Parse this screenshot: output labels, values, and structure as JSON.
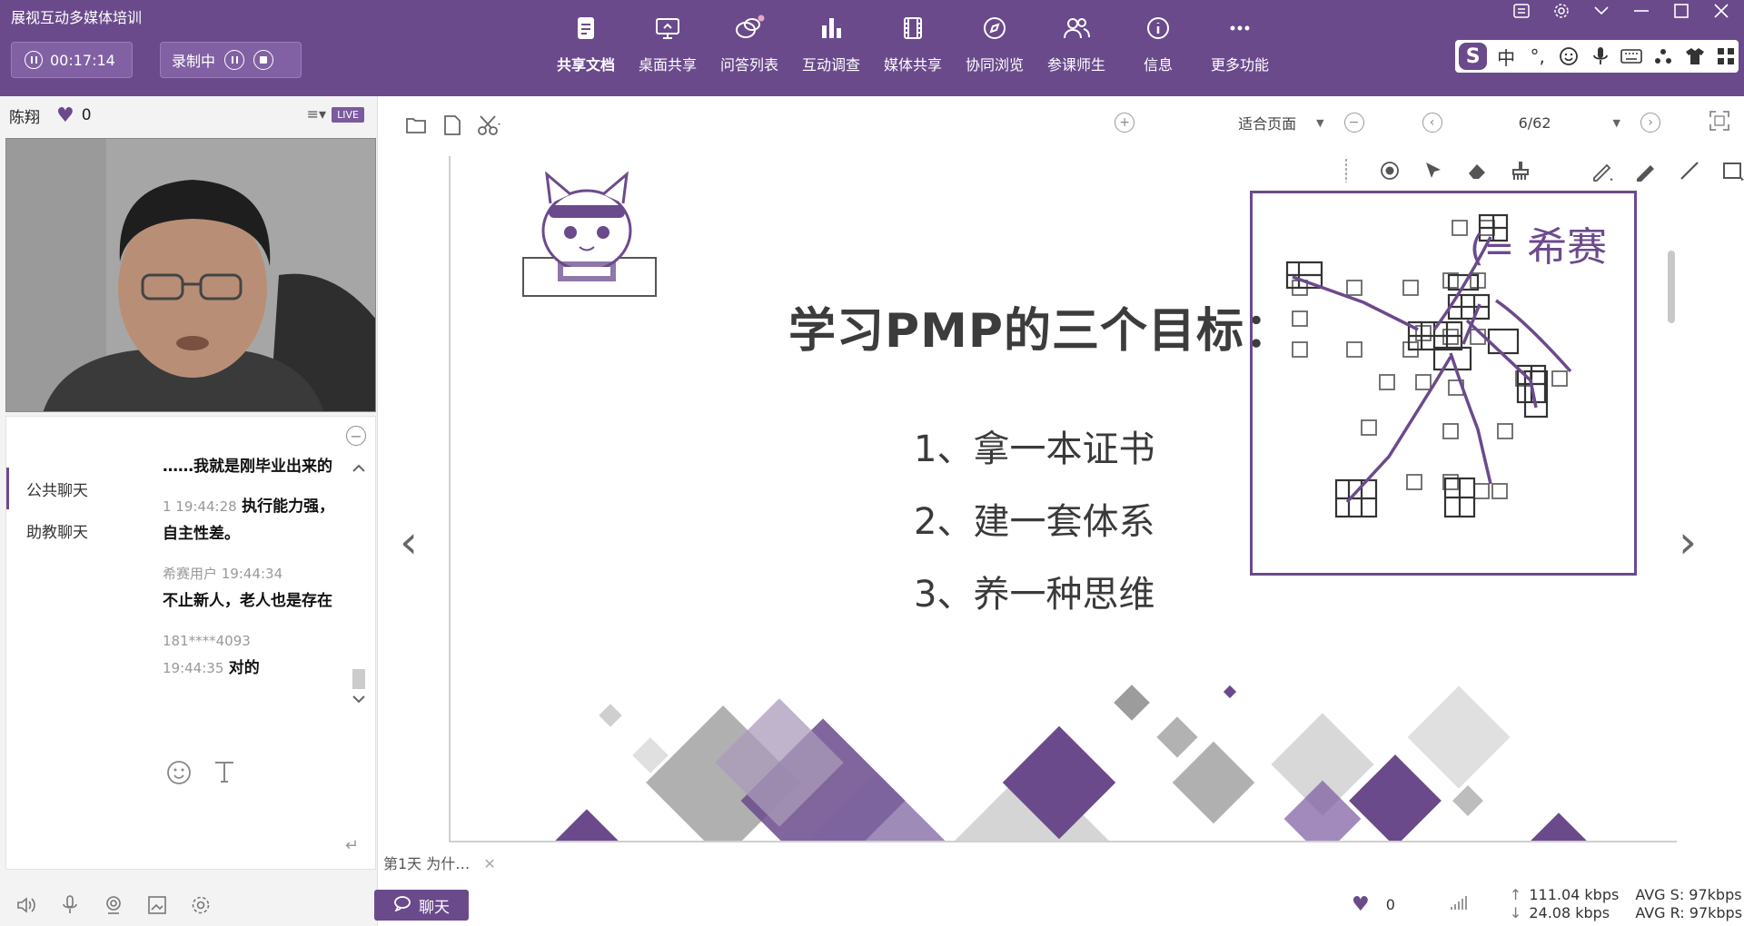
{
  "app": {
    "title": "展视互动多媒体培训"
  },
  "session": {
    "timer": "00:17:14",
    "record_label": "录制中"
  },
  "toolbar": {
    "tools": [
      {
        "label": "共享文档",
        "icon": "document-share-icon"
      },
      {
        "label": "桌面共享",
        "icon": "desktop-share-icon"
      },
      {
        "label": "问答列表",
        "icon": "qa-list-icon"
      },
      {
        "label": "互动调查",
        "icon": "survey-icon"
      },
      {
        "label": "媒体共享",
        "icon": "media-share-icon"
      },
      {
        "label": "协同浏览",
        "icon": "co-browse-icon"
      },
      {
        "label": "参课师生",
        "icon": "participants-icon"
      },
      {
        "label": "信息",
        "icon": "info-icon"
      },
      {
        "label": "更多功能",
        "icon": "more-icon"
      }
    ]
  },
  "ime": {
    "logo": "S",
    "lang": "中"
  },
  "presenter": {
    "name": "陈翔",
    "likes": "0",
    "live_badge": "LIVE"
  },
  "chat": {
    "tabs": [
      "公共聊天",
      "助教聊天"
    ],
    "messages": [
      {
        "meta": "",
        "text": "……我就是刚毕业出来的"
      },
      {
        "meta": "1 19:44:28",
        "text": "执行能力强，自主性差。"
      },
      {
        "meta": "希赛用户 19:44:34",
        "text": "不止新人，老人也是存在"
      },
      {
        "meta": "181****4093",
        "text": ""
      },
      {
        "meta": "19:44:35",
        "text": "对的"
      }
    ],
    "button_label": "聊天"
  },
  "document": {
    "fit_label": "适合页面",
    "page_indicator": "6/62",
    "tab_label": "第1天  为什…",
    "slide": {
      "title": "学习PMP的三个目标：",
      "goals": [
        "1、拿一本证书",
        "2、建一套体系",
        "3、养一种思维"
      ],
      "logo_text": "希赛"
    }
  },
  "status": {
    "likes": "0",
    "up": "111.04 kbps",
    "down": "24.08 kbps",
    "avg_s": "AVG S: 97kbps",
    "avg_r": "AVG R: 97kbps"
  },
  "colors": {
    "brand": "#6b4a8c",
    "accent": "#8161a3"
  }
}
